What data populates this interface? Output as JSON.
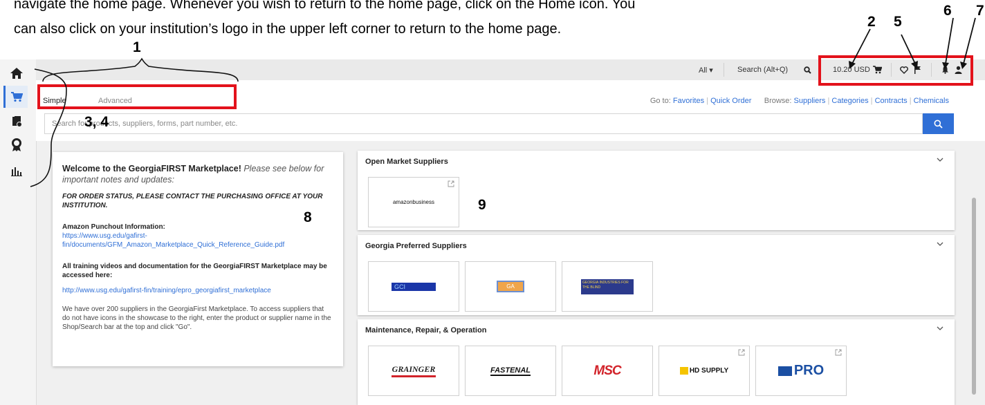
{
  "doc": {
    "line1": "navigate the home page. Whenever you wish to return to the home page, click on the Home icon. You",
    "line2": "can also click on your institution’s logo in the upper left corner to return to the home page."
  },
  "callouts": [
    "1",
    "2",
    "5",
    "6",
    "7",
    "3, 4",
    "8",
    "9"
  ],
  "colors": {
    "accent": "#2f6fd6",
    "highlight": "#e3121b"
  },
  "leftnav": [
    "home-icon",
    "cart-icon",
    "documents-icon",
    "award-icon",
    "bar-chart-icon"
  ],
  "topbar": {
    "scope": "All ▾",
    "search_label": "Search (Alt+Q)",
    "cart_total": "10.20 USD"
  },
  "shop": {
    "tab_simple": "Simple",
    "tab_advanced": "Advanced",
    "goto_label": "Go to:",
    "goto_links": [
      "Favorites",
      "Quick Order"
    ],
    "browse_label": "Browse:",
    "browse_links": [
      "Suppliers",
      "Categories",
      "Contracts",
      "Chemicals"
    ],
    "search_placeholder": "Search for products, suppliers, forms, part number, etc."
  },
  "welcome": {
    "title_bold": "Welcome to the GeorgiaFIRST Marketplace!",
    "title_rest": " Please see below for important notes and updates:",
    "order_status": "FOR ORDER STATUS, PLEASE CONTACT THE PURCHASING OFFICE AT YOUR INSTITUTION.",
    "amazon_heading": "Amazon Punchout Information:",
    "amazon_link": "https://www.usg.edu/gafirst-fin/documents/GFM_Amazon_Marketplace_Quick_Reference_Guide.pdf",
    "training_heading": "All training videos and documentation for the GeorgiaFIRST Marketplace may be accessed here:",
    "training_link": "http://www.usg.edu/gafirst-fin/training/epro_georgiafirst_marketplace",
    "suppliers_note": "We have over 200 suppliers in the GeorgiaFirst Marketplace. To access suppliers that do not have icons in the showcase to the right, enter the product or supplier name in the Shop/Search bar at the top and click \"Go\"."
  },
  "panels": [
    {
      "title": "Open Market Suppliers",
      "tiles": [
        "amazonbusiness"
      ]
    },
    {
      "title": "Georgia Preferred Suppliers",
      "tiles": [
        "GCI",
        "GA",
        "GEORGIA INDUSTRIES FOR THE BLIND"
      ]
    },
    {
      "title": "Maintenance, Repair, & Operation",
      "tiles": [
        "GRAINGER",
        "FASTENAL",
        "MSC",
        "HD SUPPLY",
        "PRO"
      ]
    }
  ]
}
